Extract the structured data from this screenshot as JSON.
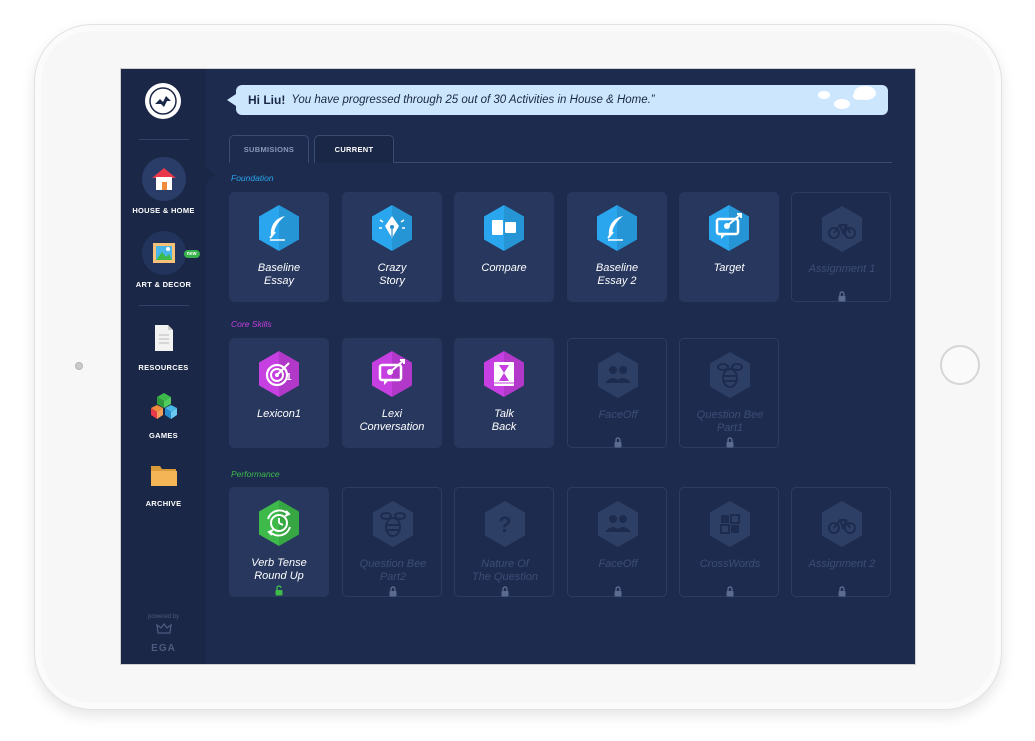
{
  "sidebar": {
    "items": [
      {
        "label": "HOUSE & HOME",
        "icon": "house-icon",
        "active": true
      },
      {
        "label": "ART & DECOR",
        "icon": "picture-icon",
        "badge": "new"
      },
      {
        "label": "RESOURCES",
        "icon": "document-icon"
      },
      {
        "label": "GAMES",
        "icon": "blocks-icon"
      },
      {
        "label": "ARCHIVE",
        "icon": "folder-icon"
      }
    ],
    "powered_by": "powered by",
    "brand": "EGA"
  },
  "message": {
    "greeting": "Hi Liu!",
    "text": "You have progressed through 25 out of 30 Activities in House & Home.”"
  },
  "tabs": [
    {
      "label": "SUBMISIONS",
      "active": false
    },
    {
      "label": "CURRENT",
      "active": true
    }
  ],
  "sections": [
    {
      "title": "Foundation",
      "color": "#2aa6ee",
      "activities": [
        {
          "name": "Baseline Essay",
          "lines": [
            "Baseline",
            "Essay"
          ],
          "icon": "quill-icon",
          "unlocked": true
        },
        {
          "name": "Crazy Story",
          "lines": [
            "Crazy",
            "Story"
          ],
          "icon": "pen-nib-icon",
          "unlocked": true
        },
        {
          "name": "Compare",
          "lines": [
            "Compare"
          ],
          "icon": "compare-icon",
          "unlocked": true
        },
        {
          "name": "Baseline Essay 2",
          "lines": [
            "Baseline",
            "Essay 2"
          ],
          "icon": "quill-icon",
          "unlocked": true
        },
        {
          "name": "Target",
          "lines": [
            "Target"
          ],
          "icon": "target-chat-icon",
          "unlocked": true
        },
        {
          "name": "Assignment 1",
          "lines": [
            "Assignment 1"
          ],
          "icon": "bicycle-icon",
          "unlocked": false
        }
      ]
    },
    {
      "title": "Core Skills",
      "color": "#c63fe0",
      "activities": [
        {
          "name": "Lexicon1",
          "lines": [
            "Lexicon1"
          ],
          "icon": "target-icon",
          "unlocked": true
        },
        {
          "name": "Lexi Conversation",
          "lines": [
            "Lexi",
            "Conversation"
          ],
          "icon": "target-chat-icon",
          "unlocked": true
        },
        {
          "name": "Talk Back",
          "lines": [
            "Talk",
            "Back"
          ],
          "icon": "book-hourglass-icon",
          "unlocked": true
        },
        {
          "name": "FaceOff",
          "lines": [
            "FaceOff"
          ],
          "icon": "people-icon",
          "unlocked": false
        },
        {
          "name": "Question Bee Part1",
          "lines": [
            "Question Bee",
            "Part1"
          ],
          "icon": "bee-icon",
          "unlocked": false
        }
      ]
    },
    {
      "title": "Performance",
      "color": "#3dba4a",
      "activities": [
        {
          "name": "Verb Tense Round Up",
          "lines": [
            "Verb Tense",
            "Round Up"
          ],
          "icon": "clock-cycle-icon",
          "unlocked": true,
          "open_lock": true
        },
        {
          "name": "Question Bee Part2",
          "lines": [
            "Question Bee",
            "Part2"
          ],
          "icon": "bee-icon",
          "unlocked": false
        },
        {
          "name": "Nature Of The Question",
          "lines": [
            "Nature Of",
            "The Question"
          ],
          "icon": "question-icon",
          "unlocked": false
        },
        {
          "name": "FaceOff",
          "lines": [
            "FaceOff"
          ],
          "icon": "people-icon",
          "unlocked": false
        },
        {
          "name": "CrossWords",
          "lines": [
            "CrossWords"
          ],
          "icon": "grid-icon",
          "unlocked": false
        },
        {
          "name": "Assignment 2",
          "lines": [
            "Assignment 2"
          ],
          "icon": "bicycle-icon",
          "unlocked": false
        }
      ]
    }
  ],
  "colors": {
    "foundation": "#2aa6ee",
    "core": "#c63fe0",
    "performance": "#3dba4a",
    "locked": "#2e3f66",
    "background": "#1d2b4f"
  }
}
